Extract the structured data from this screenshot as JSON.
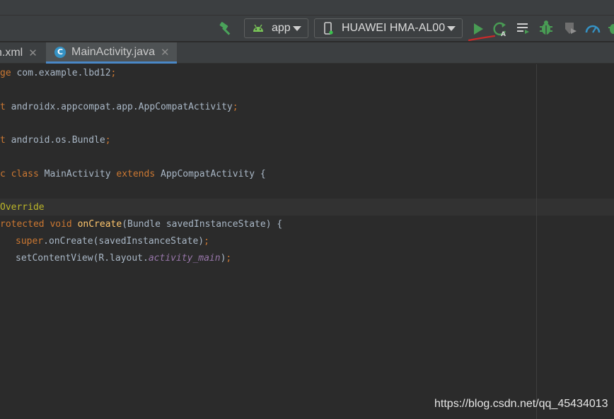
{
  "toolbar": {
    "run_config": "app",
    "device": "HUAWEI HMA-AL00",
    "icons": [
      "hammer-icon",
      "android-icon",
      "phone-icon",
      "run-icon",
      "apply-changes-icon",
      "make-icon",
      "debug-icon",
      "coverage-icon",
      "profiler-icon",
      "more-icon"
    ],
    "accent_green": "#499c54",
    "annotation_color": "#c92a2a"
  },
  "tabs": [
    {
      "label": "n.xml",
      "active": false
    },
    {
      "label": "MainActivity.java",
      "active": true,
      "icon": "class-icon",
      "icon_letter": "C"
    }
  ],
  "code": {
    "line1": {
      "kw": "ge",
      "rest": " com.example.lbd12",
      "end": ";"
    },
    "line2": {
      "kw": "t",
      "rest": " androidx.appcompat.app.AppCompatActivity",
      "end": ";"
    },
    "line3": {
      "kw": "t",
      "rest": " android.os.Bundle",
      "end": ";"
    },
    "line4": {
      "kw1": "c class",
      "name": " MainActivity ",
      "kw2": "extends",
      "rest": " AppCompatActivity {"
    },
    "line5": {
      "ann": "Override"
    },
    "line6": {
      "kw": "rotected void",
      "fn": "onCreate",
      "rest": "(Bundle savedInstanceState) {"
    },
    "line7": {
      "kw": "super",
      "rest": ".onCreate(savedInstanceState)",
      "end": ";"
    },
    "line8": {
      "rest": "setContentView(R.layout.",
      "fld": "activity_main",
      "close": ")",
      "end": ";"
    }
  },
  "watermark": "https://blog.csdn.net/qq_45434013"
}
